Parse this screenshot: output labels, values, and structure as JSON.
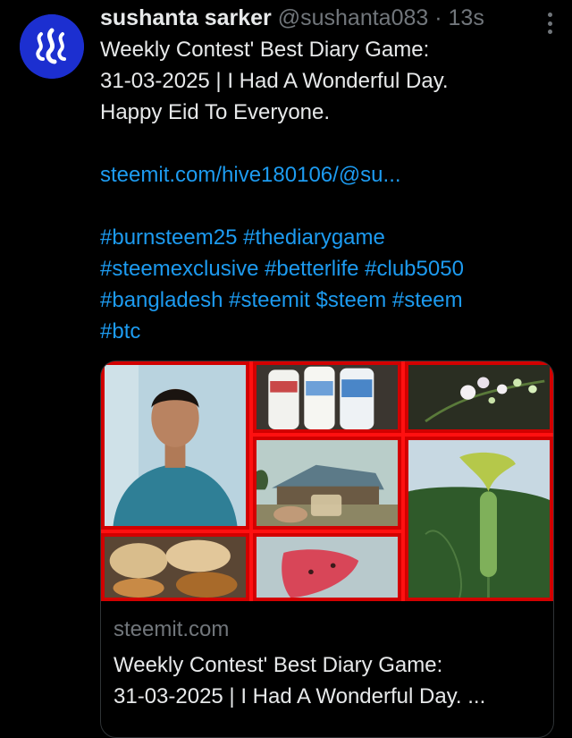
{
  "tweet": {
    "author_name": "sushanta sarker",
    "handle": "@sushanta083",
    "separator": "·",
    "time": "13s",
    "text_lines": [
      "Weekly Contest' Best Diary Game:",
      "31-03-2025 | I Had A Wonderful Day.",
      "Happy Eid To Everyone."
    ],
    "link": "steemit.com/hive180106/@su...",
    "hashtag_lines": [
      "#burnsteem25 #thediarygame",
      "#steemexclusive #betterlife #club5050",
      "#bangladesh #steemit  $steem #steem",
      "#btc"
    ]
  },
  "card": {
    "domain": "steemit.com",
    "title_lines": [
      "Weekly Contest' Best Diary Game:",
      "31-03-2025 | I Had A Wonderful Day. ..."
    ]
  },
  "icons": {
    "avatar": "steem-logo-icon",
    "more": "more-options-icon"
  },
  "colors": {
    "background": "#000000",
    "link": "#1d9bf0",
    "muted": "#71767b",
    "avatar_bg": "#1c2fd0",
    "collage_border": "#d20000"
  }
}
